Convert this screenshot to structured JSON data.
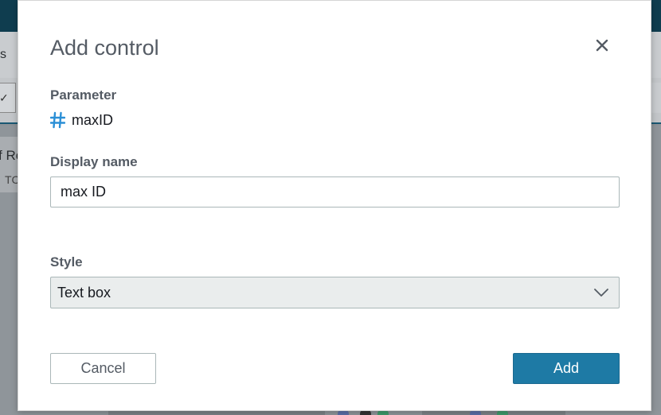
{
  "background": {
    "fragments": [
      "s",
      "✓",
      "f Re",
      "TC"
    ]
  },
  "dialog": {
    "title": "Add control",
    "close_icon": "close-icon",
    "parameter": {
      "label": "Parameter",
      "icon": "hash-icon",
      "value": "maxID"
    },
    "display_name": {
      "label": "Display name",
      "value": "max ID"
    },
    "style": {
      "label": "Style",
      "selected": "Text box"
    },
    "buttons": {
      "cancel": "Cancel",
      "add": "Add"
    }
  },
  "colors": {
    "primary": "#1e7aa5",
    "hash_icon": "#2b8fd6",
    "label": "#545b64"
  }
}
